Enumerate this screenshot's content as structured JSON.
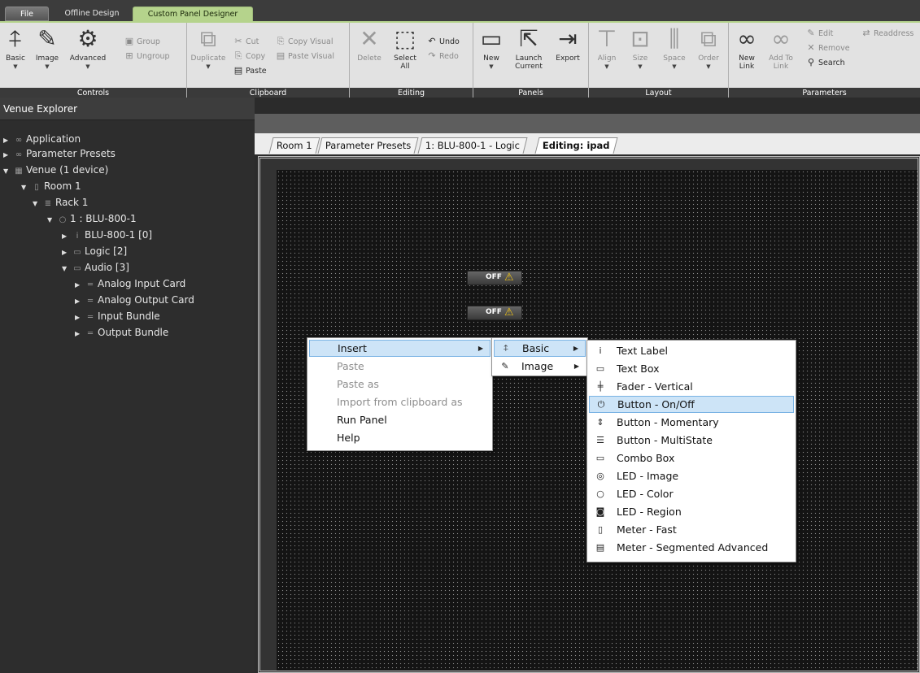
{
  "ribbon": {
    "tabs": {
      "file": "File",
      "offline": "Offline Design",
      "custom": "Custom Panel Designer"
    },
    "controls": {
      "caption": "Controls",
      "basic": "Basic",
      "image": "Image",
      "advanced": "Advanced",
      "group": "Group",
      "ungroup": "Ungroup"
    },
    "clipboard": {
      "caption": "Clipboard",
      "duplicate": "Duplicate",
      "cut": "Cut",
      "copy": "Copy",
      "paste": "Paste",
      "copy_visual": "Copy Visual",
      "paste_visual": "Paste Visual"
    },
    "editing": {
      "caption": "Editing",
      "delete": "Delete",
      "select": "Select",
      "select2": "All",
      "undo": "Undo",
      "redo": "Redo"
    },
    "panels": {
      "caption": "Panels",
      "new": "New",
      "launch": "Launch",
      "launch2": "Current",
      "export": "Export"
    },
    "layout": {
      "caption": "Layout",
      "align": "Align",
      "size": "Size",
      "space": "Space",
      "order": "Order"
    },
    "parameters": {
      "caption": "Parameters",
      "new_link": "New",
      "new_link2": "Link",
      "add_to": "Add To",
      "add_to2": "Link",
      "edit": "Edit",
      "remove": "Remove",
      "search": "Search",
      "readdress": "Readdress"
    }
  },
  "explorer": {
    "title": "Venue Explorer",
    "items": [
      {
        "label": "Application"
      },
      {
        "label": "Parameter Presets"
      },
      {
        "label": "Venue (1 device)"
      },
      {
        "label": "Room 1"
      },
      {
        "label": "Rack 1"
      },
      {
        "label": "1 : BLU-800-1"
      },
      {
        "label": "BLU-800-1 [0]"
      },
      {
        "label": "Logic [2]"
      },
      {
        "label": "Audio [3]"
      },
      {
        "label": "Analog Input Card"
      },
      {
        "label": "Analog Output Card"
      },
      {
        "label": "Input Bundle"
      },
      {
        "label": "Output Bundle"
      }
    ]
  },
  "doc_tabs": [
    "Room 1",
    "Parameter Presets",
    "1: BLU-800-1 - Logic",
    "Editing: ipad"
  ],
  "canvas": {
    "button1": "OFF",
    "button2": "OFF"
  },
  "context_menu": {
    "items": [
      "Insert",
      "Paste",
      "Paste as",
      "Import from clipboard as",
      "Run Panel",
      "Help"
    ]
  },
  "insert_menu": {
    "items": [
      "Basic",
      "Image"
    ]
  },
  "basic_menu": {
    "items": [
      "Text Label",
      "Text Box",
      "Fader - Vertical",
      "Button - On/Off",
      "Button - Momentary",
      "Button - MultiState",
      "Combo Box",
      "LED - Image",
      "LED - Color",
      "LED - Region",
      "Meter - Fast",
      "Meter - Segmented Advanced"
    ],
    "highlighted": "Button - On/Off"
  },
  "colors": {
    "accent": "#b5d38c",
    "highlight": "#cde4f7",
    "canvas": "#141414"
  }
}
